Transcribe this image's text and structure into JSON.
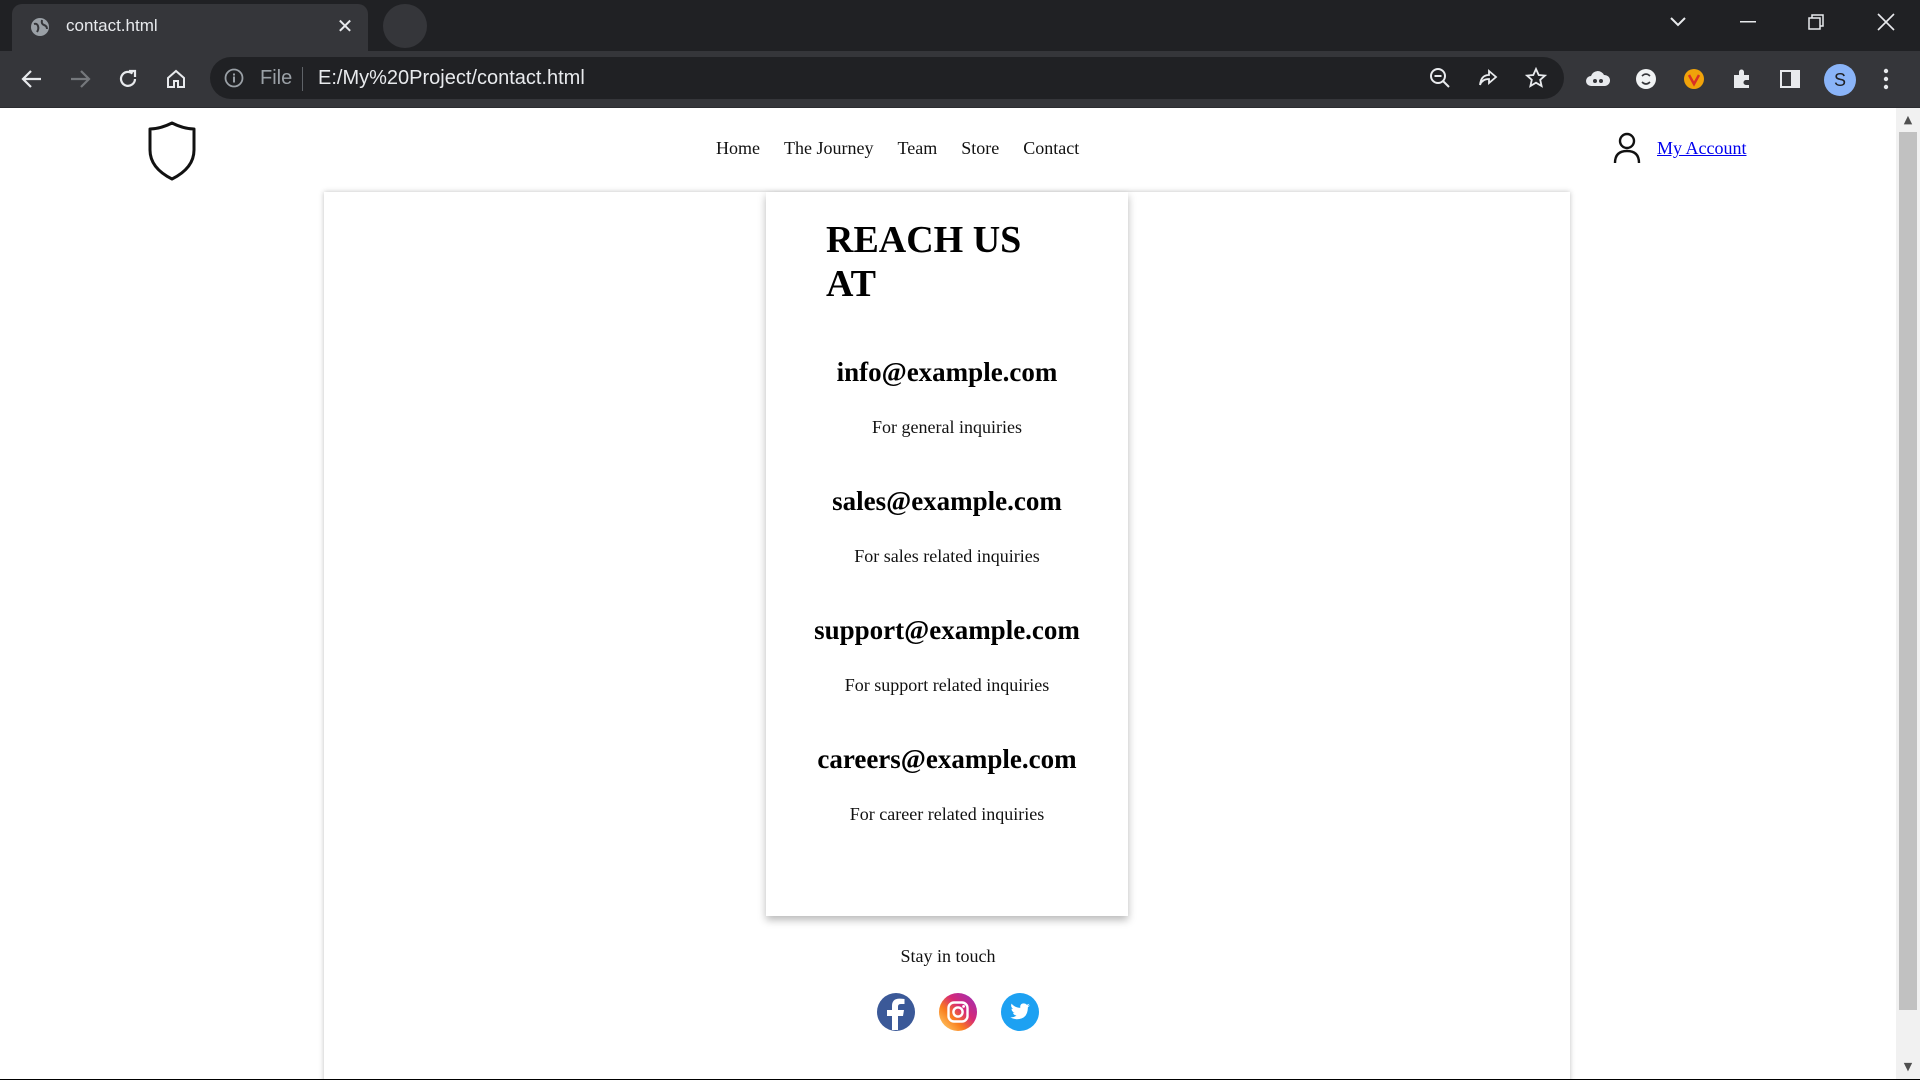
{
  "browser": {
    "tab_title": "contact.html",
    "omnibox_scheme": "File",
    "omnibox_url": "E:/My%20Project/contact.html",
    "profile_initial": "S"
  },
  "nav": {
    "links": [
      "Home",
      "The Journey",
      "Team",
      "Store",
      "Contact"
    ],
    "account_label": "My Account"
  },
  "contact": {
    "heading": "REACH US AT",
    "items": [
      {
        "email": "info@example.com",
        "description": "For general inquiries"
      },
      {
        "email": "sales@example.com",
        "description": "For sales related inquiries"
      },
      {
        "email": "support@example.com",
        "description": "For support related inquiries"
      },
      {
        "email": "careers@example.com",
        "description": "For career related inquiries"
      }
    ]
  },
  "footer": {
    "stay_label": "Stay in touch",
    "social": [
      "facebook-icon",
      "instagram-icon",
      "twitter-icon"
    ]
  },
  "colors": {
    "link": "#0000ee",
    "facebook": "#3b5998",
    "twitter": "#1da1f2"
  }
}
